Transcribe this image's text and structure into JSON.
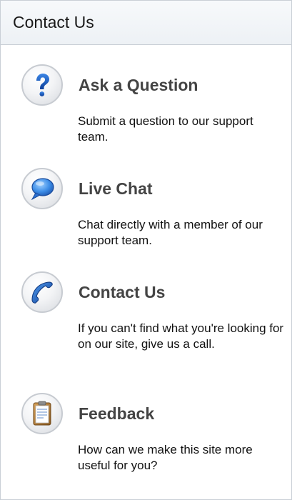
{
  "panel": {
    "title": "Contact Us"
  },
  "items": [
    {
      "title": "Ask a Question",
      "description": "Submit a question to our support team.",
      "icon": "question-mark-icon"
    },
    {
      "title": "Live Chat",
      "description": "Chat directly with a member of our support team.",
      "icon": "chat-bubble-icon"
    },
    {
      "title": "Contact Us",
      "description": "If you can't find what you're looking for on our site, give us a call.",
      "icon": "phone-icon"
    },
    {
      "title": "Feedback",
      "description": "How can we make this site more useful for you?",
      "icon": "clipboard-icon"
    }
  ],
  "colors": {
    "icon_blue": "#1f5fbf",
    "title_gray": "#444444"
  }
}
